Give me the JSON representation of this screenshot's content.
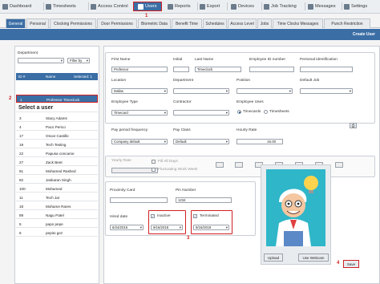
{
  "nav": {
    "items": [
      {
        "label": "Dashboard",
        "icon": "dashboard-icon"
      },
      {
        "label": "Timesheets",
        "icon": "timesheets-icon"
      },
      {
        "label": "Access Control",
        "icon": "lock-icon"
      },
      {
        "label": "Users",
        "icon": "user-icon",
        "active": true
      },
      {
        "label": "Reports",
        "icon": "chart-icon"
      },
      {
        "label": "Export",
        "icon": "export-icon"
      },
      {
        "label": "Devices",
        "icon": "device-icon"
      },
      {
        "label": "Job Tracking",
        "icon": "briefcase-icon"
      },
      {
        "label": "Messages",
        "icon": "envelope-icon"
      },
      {
        "label": "Settings",
        "icon": "gear-icon"
      }
    ]
  },
  "markers": {
    "m1": "1",
    "m2": "2",
    "m3": "3",
    "m4": "4"
  },
  "tabs": [
    "General",
    "Personal",
    "Clocking Permissions",
    "Door Permissions",
    "Biometric Data",
    "Benefit Time",
    "Schedules",
    "Access Level",
    "Jobs",
    "Time Clocks Messages",
    "Punch Restriction"
  ],
  "action": {
    "create_user": "Create User"
  },
  "left": {
    "department_label": "Department",
    "department_value": "",
    "filter_label": "Filter by",
    "list_header": {
      "id": "ID #",
      "name": "Name",
      "selected": "Selected: 1"
    },
    "selected_row": {
      "id": "1",
      "name": "Professor Timeclock"
    },
    "select_user_heading": "Select a user",
    "users": [
      {
        "id": "3",
        "name": "Stacy Adams"
      },
      {
        "id": "4",
        "name": "Paco Perico"
      },
      {
        "id": "17",
        "name": "Oscar Castillo"
      },
      {
        "id": "19",
        "name": "Tech Testing"
      },
      {
        "id": "22",
        "name": "Papusa concame"
      },
      {
        "id": "27",
        "name": "Zack Beet"
      },
      {
        "id": "81",
        "name": "Mohamed Rashed"
      },
      {
        "id": "82",
        "name": "Jaskaran Singh"
      },
      {
        "id": "100",
        "name": "Mohamed"
      },
      {
        "id": "11",
        "name": "Tech Jar"
      },
      {
        "id": "18",
        "name": "Mohame Rares"
      },
      {
        "id": "89",
        "name": "Nagu Patel"
      },
      {
        "id": "5",
        "name": "papo pepe"
      },
      {
        "id": "6",
        "name": "pepito gez"
      }
    ]
  },
  "form": {
    "first_name": {
      "label": "First Name",
      "value": "Professor"
    },
    "initial": {
      "label": "Initial",
      "value": ""
    },
    "last_name": {
      "label": "Last Name",
      "value": "Timeclock"
    },
    "employee_id": {
      "label": "Employee ID number",
      "value": ""
    },
    "personal_id": {
      "label": "Personal identification",
      "value": ""
    },
    "location": {
      "label": "Location",
      "value": "Dallas"
    },
    "department": {
      "label": "Department",
      "value": ""
    },
    "position": {
      "label": "Position",
      "value": ""
    },
    "default_job": {
      "label": "Default Job",
      "value": ""
    },
    "employee_type": {
      "label": "Employee Type",
      "value": "Timecard"
    },
    "contractor": {
      "label": "Contractor",
      "value": ""
    },
    "employee_uses": {
      "label": "Employee Uses",
      "opt1": "Timecards",
      "opt2": "Timesheets"
    },
    "pay_period": {
      "label": "Pay period frequency",
      "value": "Company default"
    },
    "pay_class": {
      "label": "Pay Class",
      "value": "Default"
    },
    "hourly_rate": {
      "label": "Hourly Rate",
      "value": "16.00"
    },
    "yearly_rate": {
      "label": "Yearly Rate",
      "value": ""
    },
    "fill_all_days": "Fill All Days",
    "fluctuating": "Fluctuating Work Week",
    "proximity_card": {
      "label": "Proximity Card",
      "value": ""
    },
    "pin_number": {
      "label": "Pin Number",
      "value": "1234"
    },
    "hired_date": {
      "label": "Hired date",
      "value": "6/24/2016"
    },
    "inactive": {
      "label": "Inactive",
      "value": "9/16/2018"
    },
    "terminated": {
      "label": "Terminated",
      "value": "9/16/2019"
    },
    "upload": "Upload",
    "use_webcam": "Use Webcam",
    "save": "Save"
  }
}
